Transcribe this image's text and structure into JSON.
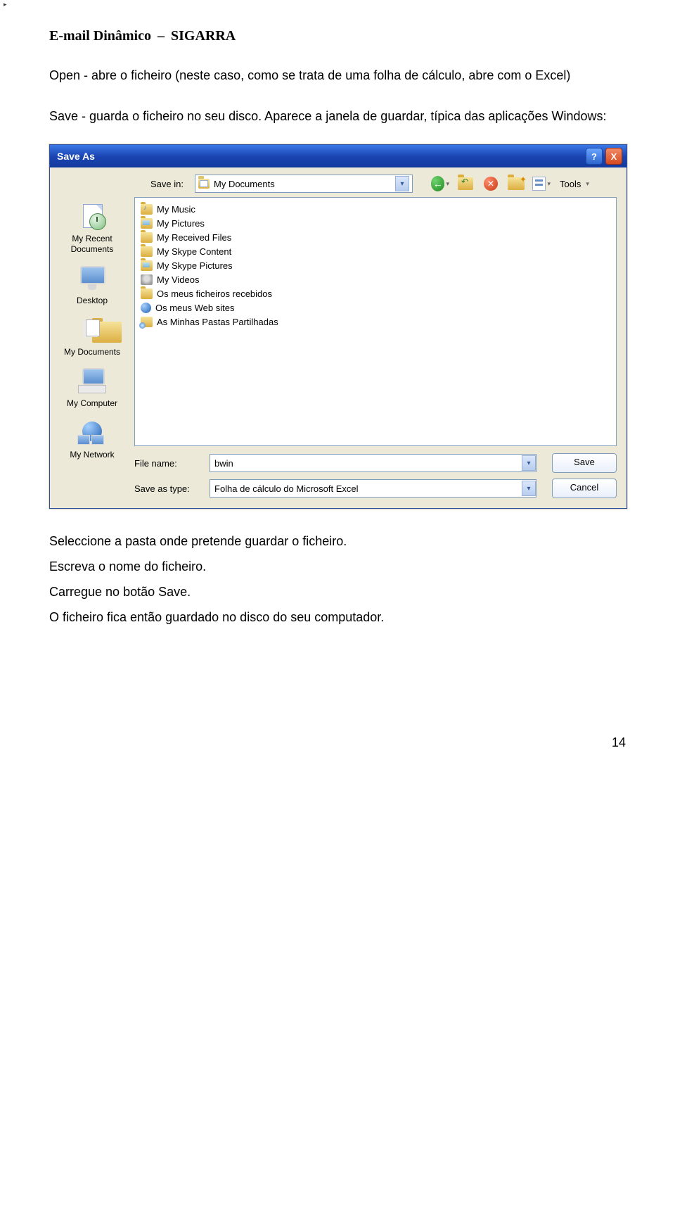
{
  "header": {
    "title": "E-mail Dinâmico",
    "separator": "–",
    "system": "SIGARRA"
  },
  "intro": {
    "p1": "Open - abre o ficheiro (neste caso, como se trata de uma folha de cálculo, abre com o Excel)",
    "p2": "Save - guarda o ficheiro no seu disco. Aparece a janela de guardar, típica das aplicações Windows:"
  },
  "dialog": {
    "title": "Save As",
    "help": "?",
    "close": "X",
    "save_in_label": "Save in:",
    "save_in_value": "My Documents",
    "tools_label": "Tools",
    "file_entries": [
      {
        "icon": "folder-music",
        "label": "My Music"
      },
      {
        "icon": "folder-pictures",
        "label": "My Pictures"
      },
      {
        "icon": "folder",
        "label": "My Received Files"
      },
      {
        "icon": "folder",
        "label": "My Skype Content"
      },
      {
        "icon": "folder-pictures",
        "label": "My Skype Pictures"
      },
      {
        "icon": "folder-video",
        "label": "My Videos"
      },
      {
        "icon": "folder",
        "label": "Os meus ficheiros recebidos"
      },
      {
        "icon": "web",
        "label": "Os meus Web sites"
      },
      {
        "icon": "share",
        "label": "As Minhas Pastas Partilhadas"
      }
    ],
    "sidebar": {
      "recent": "My Recent Documents",
      "desktop": "Desktop",
      "mydocs": "My Documents",
      "mycomp": "My Computer",
      "mynet": "My Network"
    },
    "filename_label": "File name:",
    "filename_value": "bwin",
    "saveas_label": "Save as type:",
    "saveas_value": "Folha de cálculo do Microsoft Excel",
    "save_btn": "Save",
    "cancel_btn": "Cancel"
  },
  "instructions": {
    "l1": "Seleccione a pasta onde pretende guardar o ficheiro.",
    "l2": "Escreva o nome do ficheiro.",
    "l3": "Carregue no botão Save.",
    "l4": "O ficheiro fica então guardado no disco do seu computador."
  },
  "page_number": "14"
}
